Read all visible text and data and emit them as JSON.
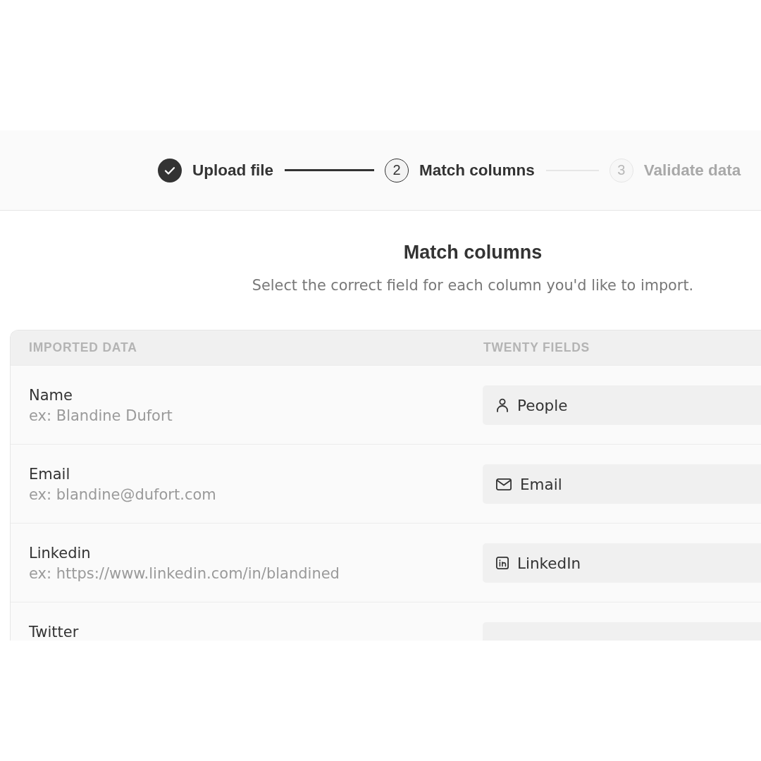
{
  "stepper": {
    "steps": [
      {
        "label": "Upload file",
        "done": true
      },
      {
        "number": "2",
        "label": "Match columns",
        "done": false
      },
      {
        "number": "3",
        "label": "Validate data",
        "done": false
      }
    ]
  },
  "header": {
    "title": "Match columns",
    "subtitle": "Select the correct field for each column you'd like to import."
  },
  "table": {
    "columns": [
      "IMPORTED DATA",
      "TWENTY FIELDS"
    ],
    "rows": [
      {
        "column": "Name",
        "example": "ex: Blandine Dufort",
        "field": {
          "kind": "person",
          "label": "People"
        }
      },
      {
        "column": "Email",
        "example": "ex: blandine@dufort.com",
        "field": {
          "kind": "mail",
          "label": "Email"
        }
      },
      {
        "column": "Linkedin",
        "example": "ex: https://www.linkedin.com/in/blandined",
        "field": {
          "kind": "linkedin",
          "label": "LinkedIn"
        }
      },
      {
        "column": "Twitter"
      }
    ]
  }
}
